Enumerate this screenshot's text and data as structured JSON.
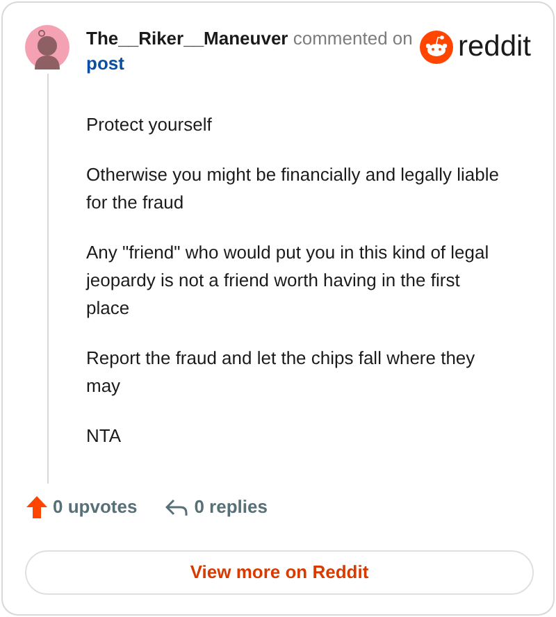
{
  "header": {
    "username": "The__Riker__Maneuver",
    "action": "commented on",
    "link": "post",
    "logo": "reddit"
  },
  "paragraphs": [
    "Protect yourself",
    "Otherwise you might be financially and legally liable for the fraud",
    "Any \"friend\" who would put you in this kind of legal jeopardy is not a friend worth having in the first place",
    "Report the fraud and let the chips fall where they may",
    "NTA"
  ],
  "footer": {
    "upvotes": "0 upvotes",
    "replies": "0 replies"
  },
  "button": "View more on Reddit"
}
